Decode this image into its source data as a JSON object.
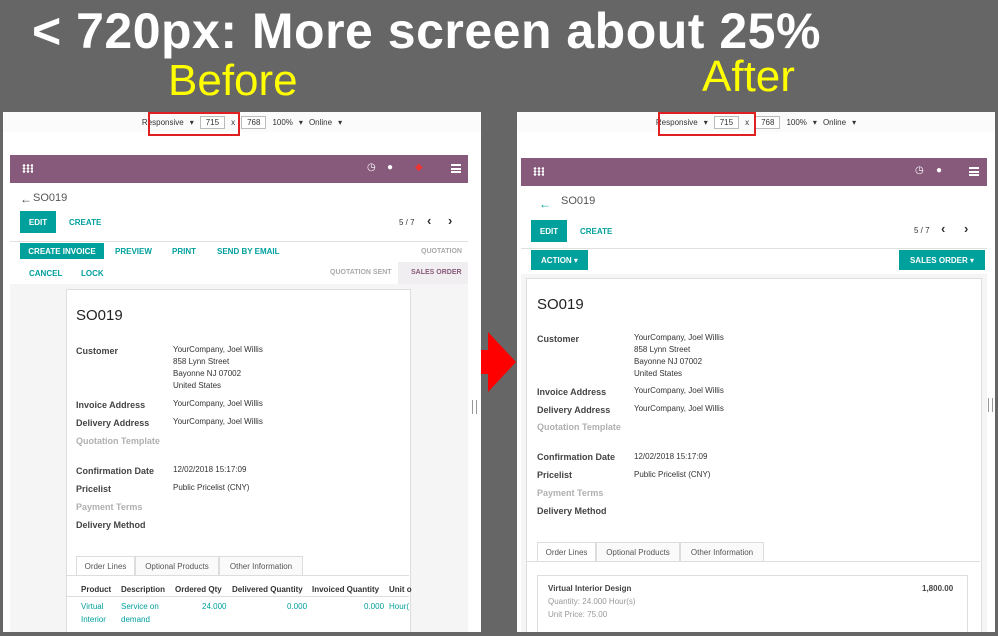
{
  "headline": "< 720px: More screen about 25%",
  "labels": {
    "before": "Before",
    "after": "After"
  },
  "devtools": {
    "mode": "Responsive",
    "width": "715",
    "height": "768",
    "zoom": "100%",
    "network": "Online"
  },
  "breadcrumb": "SO019",
  "buttons": {
    "edit": "EDIT",
    "create": "CREATE",
    "create_invoice": "CREATE INVOICE",
    "preview": "PREVIEW",
    "print": "PRINT",
    "send_email": "SEND BY EMAIL",
    "cancel": "CANCEL",
    "lock": "LOCK",
    "action": "ACTION",
    "sales_order_menu": "SALES ORDER"
  },
  "pager": "5 / 7",
  "statusbar": {
    "quotation": "QUOTATION",
    "quotation_sent": "QUOTATION SENT",
    "sales_order": "SALES ORDER"
  },
  "form": {
    "title": "SO019",
    "customer_label": "Customer",
    "customer_name": "YourCompany, Joel Willis",
    "address1": "858 Lynn Street",
    "address2": "Bayonne NJ 07002",
    "address3": "United States",
    "invoice_address_label": "Invoice Address",
    "invoice_address": "YourCompany, Joel Willis",
    "delivery_address_label": "Delivery Address",
    "delivery_address": "YourCompany, Joel Willis",
    "quotation_template_label": "Quotation Template",
    "confirmation_date_label": "Confirmation Date",
    "confirmation_date": "12/02/2018 15:17:09",
    "pricelist_label": "Pricelist",
    "pricelist": "Public Pricelist (CNY)",
    "payment_terms_label": "Payment Terms",
    "delivery_method_label": "Delivery Method"
  },
  "tabs": {
    "order_lines": "Order Lines",
    "optional_products": "Optional Products",
    "other_information": "Other Information"
  },
  "table": {
    "headers": [
      "Product",
      "Description",
      "Ordered Qty",
      "Delivered Quantity",
      "Invoiced Quantity",
      "Unit o"
    ],
    "row": {
      "product_1": "Virtual",
      "product_2": "Interior",
      "description_1": "Service on",
      "description_2": "demand",
      "ordered": "24.000",
      "delivered": "0.000",
      "invoiced": "0.000",
      "unit": "Hour("
    }
  },
  "card": {
    "product": "Virtual Interior Design",
    "amount": "1,800.00",
    "quantity": "Quantity: 24.000 Hour(s)",
    "unit_price": "Unit Price: 75.00"
  }
}
